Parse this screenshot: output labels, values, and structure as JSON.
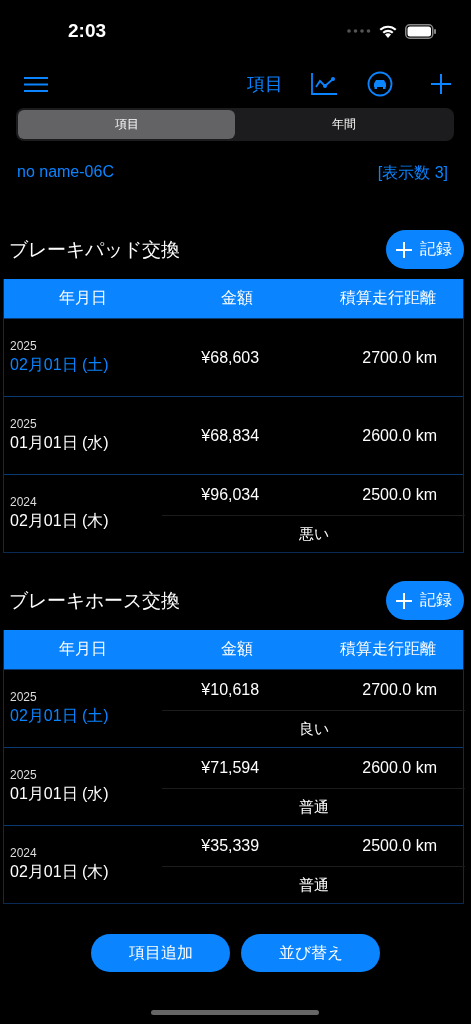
{
  "status_bar": {
    "time": "2:03"
  },
  "toolbar": {
    "title_button": "項目"
  },
  "segments": [
    {
      "label": "項目",
      "selected": true
    },
    {
      "label": "年間",
      "selected": false
    }
  ],
  "vehicle": {
    "name": "no name-06C",
    "display_count": "[表示数 3]"
  },
  "sections": [
    {
      "title": "ブレーキパッド交換",
      "record_button": "記録",
      "columns": [
        "年月日",
        "金額",
        "積算走行距離"
      ],
      "rows": [
        {
          "year": "2025",
          "date": "02月01日 (土)",
          "highlighted": true,
          "amount": "¥68,603",
          "distance": "2700.0 km"
        },
        {
          "year": "2025",
          "date": "01月01日 (水)",
          "highlighted": false,
          "amount": "¥68,834",
          "distance": "2600.0 km"
        },
        {
          "year": "2024",
          "date": "02月01日 (木)",
          "highlighted": false,
          "amount": "¥96,034",
          "distance": "2500.0 km",
          "note": "悪い"
        }
      ]
    },
    {
      "title": "ブレーキホース交換",
      "record_button": "記録",
      "columns": [
        "年月日",
        "金額",
        "積算走行距離"
      ],
      "rows": [
        {
          "year": "2025",
          "date": "02月01日 (土)",
          "highlighted": true,
          "amount": "¥10,618",
          "distance": "2700.0 km",
          "note": "良い"
        },
        {
          "year": "2025",
          "date": "01月01日 (水)",
          "highlighted": false,
          "amount": "¥71,594",
          "distance": "2600.0 km",
          "note": "普通"
        },
        {
          "year": "2024",
          "date": "02月01日 (木)",
          "highlighted": false,
          "amount": "¥35,339",
          "distance": "2500.0 km",
          "note": "普通"
        }
      ]
    }
  ],
  "bottom_buttons": [
    "項目追加",
    "並び替え"
  ]
}
